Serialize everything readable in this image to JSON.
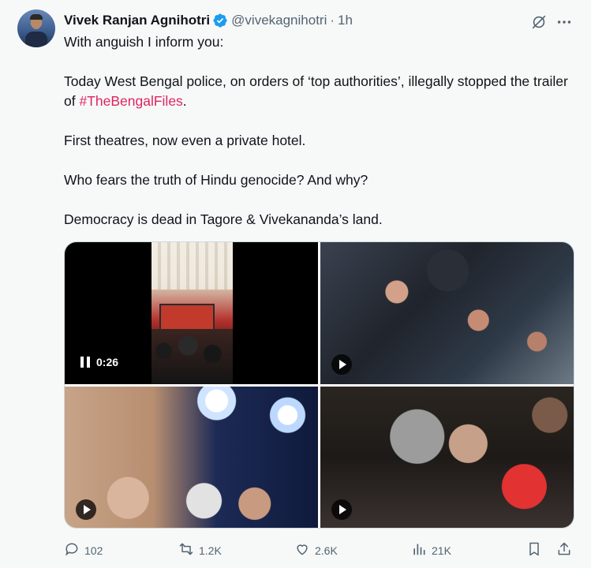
{
  "author": {
    "name": "Vivek Ranjan Agnihotri",
    "handle": "@vivekagnihotri",
    "separator": "·",
    "time": "1h",
    "verified_color": "#1d9bf0"
  },
  "tweet": {
    "paragraphs": [
      {
        "text": "With anguish I inform you:"
      },
      {
        "before": "Today West Bengal police, on orders of ‘top authorities’, illegally stopped the trailer of ",
        "hashtag": "#TheBengalFiles",
        "after": "."
      },
      {
        "text": "First theatres, now even a private hotel."
      },
      {
        "text": "Who fears the truth of Hindu genocide? And why?"
      },
      {
        "text": "Democracy is dead in Tagore & Vivekananda’s land."
      }
    ],
    "hashtag_color": "#e0245e"
  },
  "media": {
    "video_time": "0:26",
    "tiles": [
      {
        "kind": "video",
        "state": "paused"
      },
      {
        "kind": "video",
        "state": "play"
      },
      {
        "kind": "video",
        "state": "play"
      },
      {
        "kind": "video",
        "state": "play"
      }
    ]
  },
  "actions": {
    "replies": "102",
    "reposts": "1.2K",
    "likes": "2.6K",
    "views": "21K",
    "icons": [
      "reply-icon",
      "repost-icon",
      "like-icon",
      "views-icon",
      "bookmark-icon",
      "share-icon"
    ]
  },
  "header_icons": [
    "grok-icon",
    "more-icon"
  ]
}
